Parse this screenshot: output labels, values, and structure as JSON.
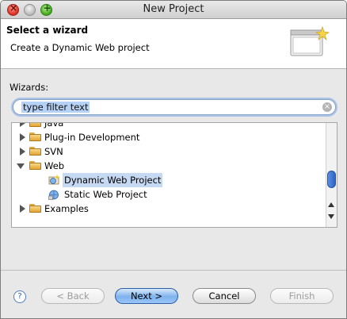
{
  "window": {
    "title": "New Project"
  },
  "banner": {
    "title": "Select a wizard",
    "subtitle": "Create a Dynamic Web project"
  },
  "wizards": {
    "label": "Wizards:",
    "filter": {
      "value": "type filter text",
      "placeholder": "type filter text"
    },
    "tree": [
      {
        "label": "Java",
        "type": "folder",
        "expanded": false,
        "partially_hidden": true
      },
      {
        "label": "Plug-in Development",
        "type": "folder",
        "expanded": false
      },
      {
        "label": "SVN",
        "type": "folder",
        "expanded": false
      },
      {
        "label": "Web",
        "type": "folder",
        "expanded": true
      },
      {
        "label": "Dynamic Web Project",
        "type": "project",
        "selected": true
      },
      {
        "label": "Static Web Project",
        "type": "project",
        "selected": false
      },
      {
        "label": "Examples",
        "type": "folder",
        "expanded": false
      }
    ]
  },
  "buttons": {
    "help": "?",
    "back": "< Back",
    "next": "Next >",
    "cancel": "Cancel",
    "finish": "Finish"
  },
  "colors": {
    "selection": "#c6d9f3",
    "default_button": "#7eb2ee",
    "folder": "#f9d889"
  }
}
